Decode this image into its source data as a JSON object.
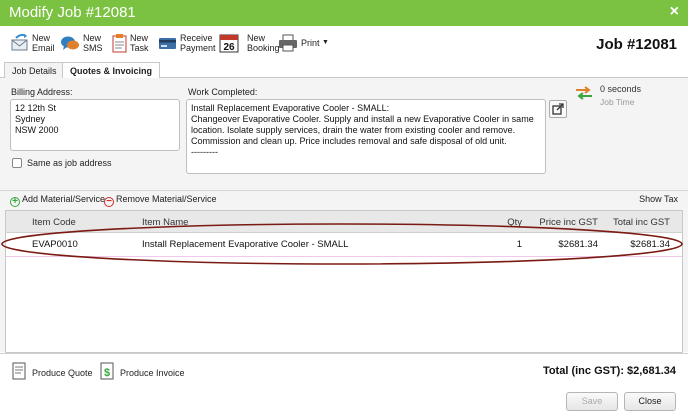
{
  "window": {
    "title": "Modify Job #12081",
    "close_glyph": "×"
  },
  "toolbar": {
    "items": [
      {
        "label": "New\nEmail",
        "icon": "email-icon"
      },
      {
        "label": "New\nSMS",
        "icon": "sms-icon"
      },
      {
        "label": "New\nTask",
        "icon": "task-icon"
      },
      {
        "label": "Receive\nPayment",
        "icon": "payment-icon"
      },
      {
        "label": "New\nBooking",
        "icon": "calendar-icon",
        "icon_text": "26"
      },
      {
        "label": "Print",
        "icon": "printer-icon"
      }
    ],
    "job_title": "Job #12081"
  },
  "tabs": [
    {
      "label": "Job Details",
      "active": false
    },
    {
      "label": "Quotes & Invoicing",
      "active": true
    }
  ],
  "billing": {
    "label": "Billing Address:",
    "address": "12 12th St\nSydney\nNSW 2000",
    "same_as_job_label": "Same as job address"
  },
  "work": {
    "label": "Work Completed:",
    "text": "Install Replacement Evaporative Cooler - SMALL:\nChangeover Evaporative Cooler. Supply and install a new Evaporative Cooler in same location. Isolate supply services, drain the water from existing cooler and remove. Commission and clean up. Price includes removal and safe disposal of old unit.\n---------"
  },
  "job_time": {
    "value": "0 seconds",
    "label": "Job Time"
  },
  "actions": {
    "add_label": "Add Material/Service",
    "remove_label": "Remove Material/Service",
    "show_tax_label": "Show Tax"
  },
  "grid": {
    "headers": {
      "code": "Item Code",
      "name": "Item Name",
      "qty": "Qty",
      "price": "Price inc GST",
      "total": "Total inc GST"
    },
    "rows": [
      {
        "code": "EVAP0010",
        "name": "Install Replacement Evaporative Cooler - SMALL",
        "qty": "1",
        "price": "$2681.34",
        "total": "$2681.34"
      }
    ]
  },
  "footer": {
    "produce_quote": "Produce Quote",
    "produce_invoice": "Produce Invoice",
    "total": "Total (inc GST): $2,681.34",
    "save_label": "Save",
    "close_label": "Close"
  },
  "colors": {
    "titlebar": "#7cc242",
    "highlight_ellipse": "#7a1a12",
    "add_green": "#3aa53a",
    "remove_red": "#d22c2c"
  }
}
